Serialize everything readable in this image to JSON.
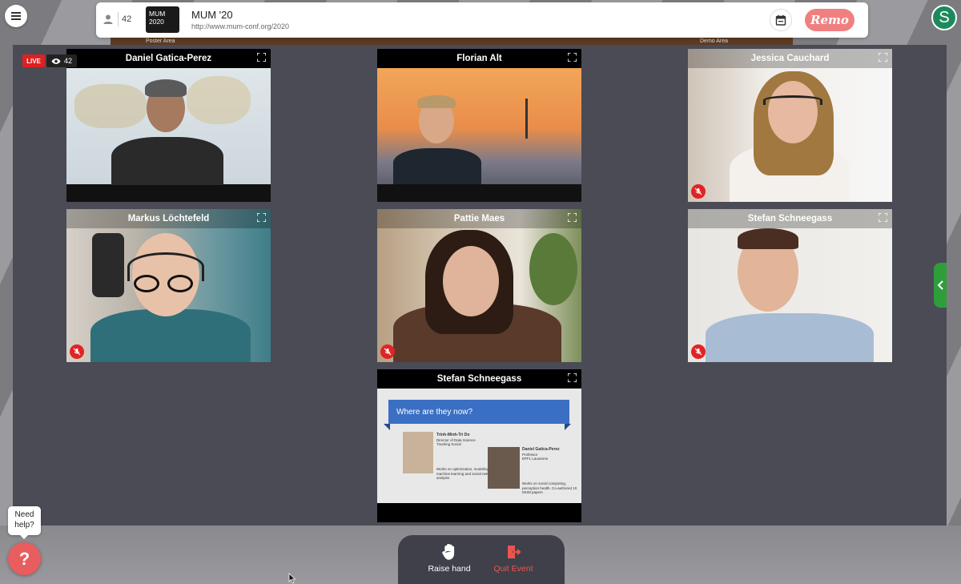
{
  "header": {
    "attendee_count": "42",
    "logo_line1": "MUM",
    "logo_line2": "2020",
    "event_title": "MUM '20",
    "event_url": "http://www.mum-conf.org/2020",
    "brand": "Remo"
  },
  "user": {
    "avatar_initial": "S"
  },
  "room_strip": [
    "Poster Area",
    "Demo Area"
  ],
  "stage": {
    "live_label": "LIVE",
    "viewer_count": "42",
    "tiles": [
      {
        "name": "Daniel Gatica-Perez",
        "muted": false
      },
      {
        "name": "Florian Alt",
        "muted": false
      },
      {
        "name": "Jessica Cauchard",
        "muted": true
      },
      {
        "name": "Markus Löchtefeld",
        "muted": true
      },
      {
        "name": "Pattie Maes",
        "muted": true
      },
      {
        "name": "Stefan Schneegass",
        "muted": true
      },
      {
        "name": "Stefan Schneegass",
        "muted": false
      }
    ],
    "slide": {
      "title": "Where are they now?",
      "person1_name": "Trinh-Minh-Tri Do",
      "person1_role": "Director of Data Science",
      "person1_org": "Tracking Social",
      "person1_desc": "Works on optimization, modeling, machine learning and social network analysis",
      "person2_name": "Daniel Gatica-Perez",
      "person2_role": "Professor",
      "person2_org": "EPFL Lausanne",
      "person2_desc": "Works on social computing, perception health. Co-authored 10 MUM papers"
    }
  },
  "controls": {
    "raise_hand": "Raise hand",
    "quit_event": "Quit Event"
  },
  "help": {
    "bubble_line1": "Need",
    "bubble_line2": "help?"
  },
  "colors": {
    "stage_bg": "#4a4b55",
    "live_red": "#e02020",
    "remo_pink": "#f08080",
    "avatar_green": "#1d8a5e",
    "quit_red": "#ef5350",
    "drawer_green": "#2e9e3a"
  }
}
